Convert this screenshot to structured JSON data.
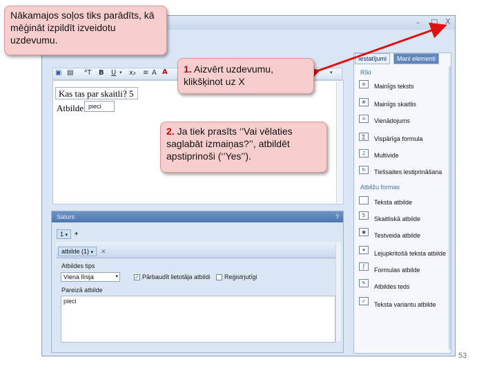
{
  "callout_top": "Nākamajos soļos tiks parādīts, kā mēģināt izpildīt izveidotu uzdevumu.",
  "step1": {
    "num": "1.",
    "text": "Aizvērt uzdevumu, klikšķinot uz X"
  },
  "step2": {
    "num": "2.",
    "text": "Ja tiek prasīts ‘’Vai vēlaties saglabāt izmaiņas?’’, atbildēt apstiprinoši (‘’Yes’’)."
  },
  "window": {
    "close_glyph": "X"
  },
  "editor": {
    "question": "Kas tas par skaitli?",
    "number": "5",
    "answer_label": "Atbilde:",
    "answer_value": "pieci"
  },
  "lower_panel": {
    "header": "Saturs",
    "pin": "?",
    "spinner": "1",
    "add": "+",
    "answer_tab": "atbilde (1)",
    "answer_type_label": "Atbildes tips",
    "answer_type_value": "Viena līnija",
    "check1": "Pārbaudīt lietotāja atbildi",
    "check2": "Reģistrjutīgi",
    "correct_label": "Pareizā atbilde",
    "correct_value": "pieci"
  },
  "right_pane": {
    "tab1": "Iestatījumi",
    "tab2": "Mani elementi",
    "section1": "Rīki",
    "tools": [
      {
        "label": "Mainīgs teksts",
        "icon": "text-icon"
      },
      {
        "label": "Mainīgs skaitlis",
        "icon": "number-icon"
      },
      {
        "label": "Vienādojums",
        "icon": "equation-icon"
      },
      {
        "label": "Vispārīga formula",
        "icon": "formula-icon"
      },
      {
        "label": "Multivide",
        "icon": "media-icon"
      },
      {
        "label": "Tiešsaites iestiprināšana",
        "icon": "link-icon"
      }
    ],
    "section2": "Atbilžu formas",
    "forms": [
      {
        "label": "Teksta atbilde",
        "icon": "textbox-icon"
      },
      {
        "label": "Skaitliskā atbilde",
        "icon": "numeric-icon"
      },
      {
        "label": "Testveida atbilde",
        "icon": "radio-icon"
      },
      {
        "label": "Lejupkritošā teksta atbilde",
        "icon": "dropdown-icon"
      },
      {
        "label": "Formulas atbilde",
        "icon": "formula-answer-icon"
      },
      {
        "label": "Atbildes teds",
        "icon": "draw-icon"
      },
      {
        "label": "Teksta variantu atbilde",
        "icon": "variant-icon"
      }
    ]
  },
  "slide_number": "53"
}
